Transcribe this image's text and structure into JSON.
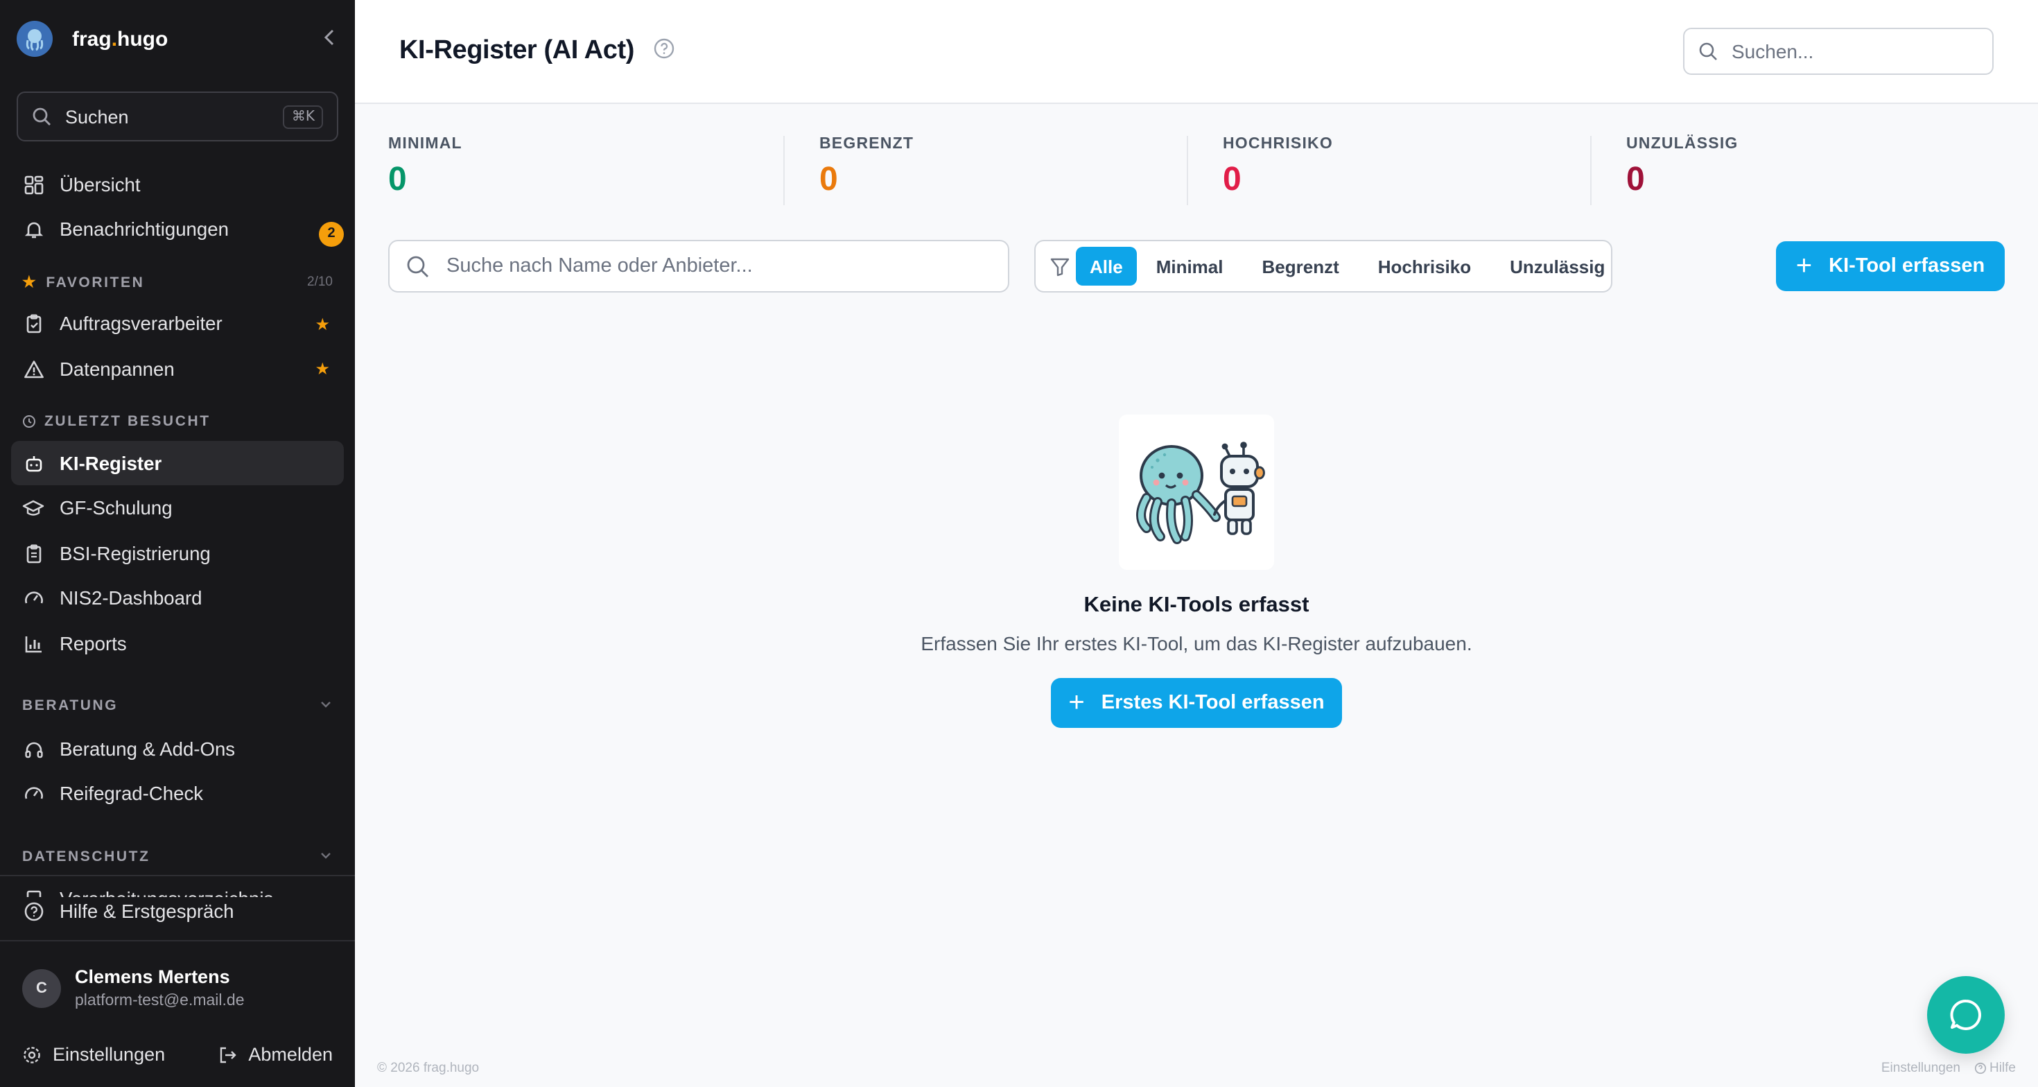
{
  "app": {
    "brand_prefix": "frag",
    "brand_dot": ".",
    "brand_suffix": "hugo"
  },
  "sidebar": {
    "search_label": "Suchen",
    "search_shortcut": "⌘K",
    "items_top": [
      {
        "label": "Übersicht",
        "icon": "grid-icon"
      },
      {
        "label": "Benachrichtigungen",
        "icon": "bell-icon",
        "badge": "2"
      }
    ],
    "favorites": {
      "title": "FAVORITEN",
      "count": "2/10",
      "items": [
        {
          "label": "Auftragsverarbeiter",
          "icon": "clipboard-icon"
        },
        {
          "label": "Datenpannen",
          "icon": "warning-icon"
        }
      ]
    },
    "recent": {
      "title": "ZULETZT BESUCHT",
      "items": [
        {
          "label": "KI-Register",
          "icon": "robot-icon",
          "active": true
        },
        {
          "label": "GF-Schulung",
          "icon": "graduation-cap-icon"
        },
        {
          "label": "BSI-Registrierung",
          "icon": "clipboard-list-icon"
        },
        {
          "label": "NIS2-Dashboard",
          "icon": "gauge-icon"
        },
        {
          "label": "Reports",
          "icon": "bar-chart-icon"
        }
      ]
    },
    "beratung": {
      "title": "BERATUNG",
      "items": [
        {
          "label": "Beratung & Add-Ons",
          "icon": "headphones-icon"
        },
        {
          "label": "Reifegrad-Check",
          "icon": "gauge-icon"
        }
      ]
    },
    "datenschutz": {
      "title": "DATENSCHUTZ",
      "partial_item": "Verarbeitungsverzeichnis"
    },
    "help_label": "Hilfe & Erstgespräch",
    "user": {
      "initial": "C",
      "name": "Clemens Mertens",
      "email": "platform-test@e.mail.de",
      "settings_label": "Einstellungen",
      "logout_label": "Abmelden"
    }
  },
  "header": {
    "title": "KI-Register (AI Act)",
    "search_placeholder": "Suchen..."
  },
  "stats": [
    {
      "label": "MINIMAL",
      "value": "0",
      "color": "#059669"
    },
    {
      "label": "BEGRENZT",
      "value": "0",
      "color": "#ea7a0c"
    },
    {
      "label": "HOCHRISIKO",
      "value": "0",
      "color": "#e11d48"
    },
    {
      "label": "UNZULÄSSIG",
      "value": "0",
      "color": "#9f1239"
    }
  ],
  "filters": {
    "search_placeholder": "Suche nach Name oder Anbieter...",
    "options": [
      "Alle",
      "Minimal",
      "Begrenzt",
      "Hochrisiko",
      "Unzulässig"
    ],
    "selected": "Alle",
    "add_button": "KI-Tool erfassen"
  },
  "empty_state": {
    "title": "Keine KI-Tools erfasst",
    "subtitle": "Erfassen Sie Ihr erstes KI-Tool, um das KI-Register aufzubauen.",
    "cta": "Erstes KI-Tool erfassen"
  },
  "footer": {
    "copyright": "© 2026 frag.hugo",
    "settings": "Einstellungen",
    "help": "Hilfe"
  },
  "colors": {
    "accent": "#0ea5e9",
    "sidebar_bg": "#18181b",
    "chat": "#14b8a6",
    "favorite": "#f59e0b"
  }
}
